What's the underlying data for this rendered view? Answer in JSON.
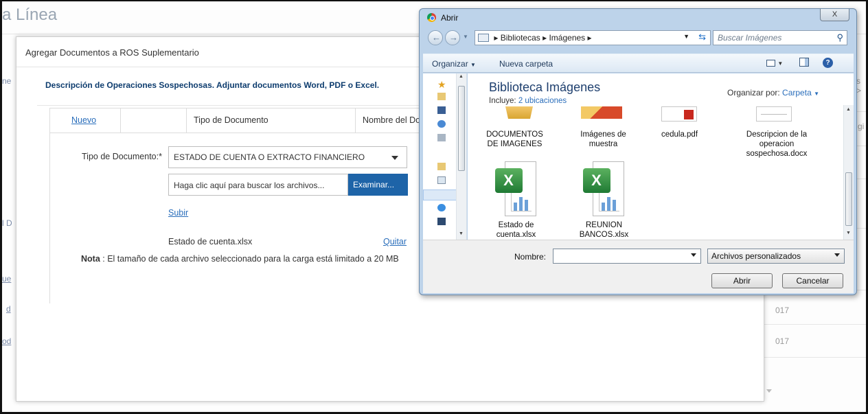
{
  "background": {
    "title_fragment": "a Línea",
    "left_fragment_ne": "ne",
    "left_fragment_d": "l D",
    "left_fragment_ue": "ue",
    "left_fragment_d2": "d",
    "left_fragment_od": "od",
    "right_fragment_s": "s >",
    "right_fragment_gi": "gi",
    "date_1": "017",
    "date_2": "017"
  },
  "modal": {
    "title": "Agregar Documentos a ROS Suplementario",
    "description": "Descripción de Operaciones Sospechosas. Adjuntar documentos Word, PDF o Excel.",
    "grid": {
      "col_new": "Nuevo",
      "col_doc_type": "Tipo de Documento",
      "col_doc_name": "Nombre del Do"
    },
    "form": {
      "doc_type_label": "Tipo de Documento:*",
      "doc_type_value": "ESTADO DE CUENTA O EXTRACTO FINANCIERO",
      "file_placeholder": "Haga clic aquí para buscar los archivos...",
      "browse_button": "Examinar...",
      "upload_link": "Subir",
      "attached_file": "Estado de cuenta.xlsx",
      "remove_link": "Quitar",
      "note_bold": "Nota",
      "note_text": " : El tamaño de cada archivo seleccionado para la carga está limitado a 20 MB"
    }
  },
  "dialog": {
    "title": "Abrir",
    "close": "X",
    "address": {
      "crumb_1": "Bibliotecas",
      "crumb_2": "Imágenes",
      "search_placeholder": "Buscar Imágenes"
    },
    "toolbar": {
      "organize": "Organizar",
      "new_folder": "Nueva carpeta"
    },
    "library": {
      "title": "Biblioteca Imágenes",
      "includes_label": "Incluye:",
      "includes_link": "2 ubicaciones",
      "arrange_label": "Organizar por:",
      "arrange_value": "Carpeta"
    },
    "files": [
      {
        "name_line1": "DOCUMENTOS",
        "name_line2": "DE IMAGENES",
        "name_line3": "",
        "icon": "folder-icon"
      },
      {
        "name_line1": "Imágenes de",
        "name_line2": "muestra",
        "name_line3": "",
        "icon": "folder-icon"
      },
      {
        "name_line1": "cedula.pdf",
        "name_line2": "",
        "name_line3": "",
        "icon": "pdf-file-icon"
      },
      {
        "name_line1": "Descripcion de la",
        "name_line2": "operacion",
        "name_line3": "sospechosa.docx",
        "icon": "word-file-icon"
      },
      {
        "name_line1": "Estado de",
        "name_line2": "cuenta.xlsx",
        "name_line3": "",
        "icon": "excel-file-icon"
      },
      {
        "name_line1": "REUNION",
        "name_line2": "BANCOS.xlsx",
        "name_line3": "",
        "icon": "excel-file-icon"
      }
    ],
    "bottom": {
      "name_label": "Nombre:",
      "name_value": "",
      "file_type": "Archivos personalizados",
      "open_button": "Abrir",
      "cancel_button": "Cancelar"
    }
  },
  "colors": {
    "primary_button": "#1e64a8",
    "link": "#2a6ebb",
    "heading": "#0d3c6e",
    "dialog_frame": "#bdd3ea"
  }
}
